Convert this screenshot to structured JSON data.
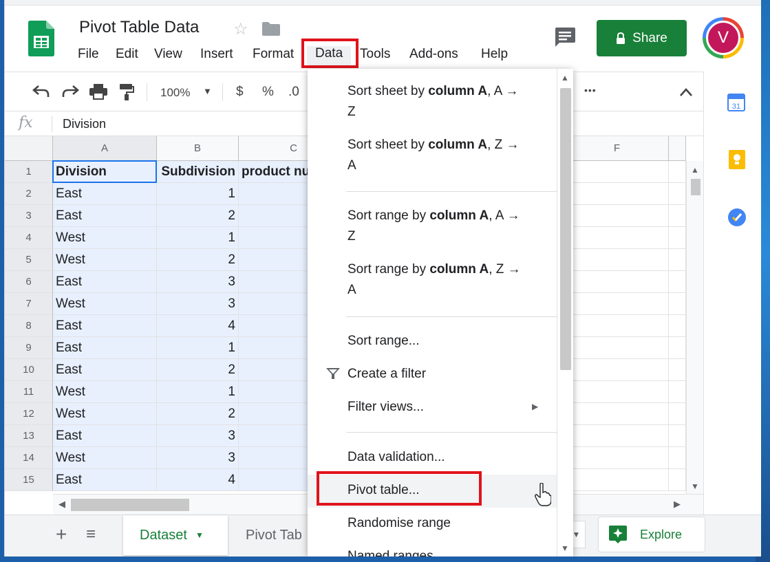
{
  "doc": {
    "title": "Pivot Table Data"
  },
  "menus": [
    "File",
    "Edit",
    "View",
    "Insert",
    "Format",
    "Data",
    "Tools",
    "Add-ons",
    "Help"
  ],
  "header": {
    "share_label": "Share",
    "avatar_initial": "V"
  },
  "toolbar": {
    "zoom": "100%",
    "currency": "$",
    "percent": "%",
    "decimal": ".0",
    "more": "•••"
  },
  "formula_bar": {
    "fx": "fx",
    "value": "Division"
  },
  "grid": {
    "columns": [
      "A",
      "B",
      "C",
      "F"
    ],
    "header_row": [
      "Division",
      "Subdivision",
      "product nu"
    ],
    "rows": [
      {
        "n": "1"
      },
      {
        "n": "2",
        "a": "East",
        "b": "1"
      },
      {
        "n": "3",
        "a": "East",
        "b": "2"
      },
      {
        "n": "4",
        "a": "West",
        "b": "1"
      },
      {
        "n": "5",
        "a": "West",
        "b": "2"
      },
      {
        "n": "6",
        "a": "East",
        "b": "3"
      },
      {
        "n": "7",
        "a": "West",
        "b": "3"
      },
      {
        "n": "8",
        "a": "East",
        "b": "4"
      },
      {
        "n": "9",
        "a": "East",
        "b": "1"
      },
      {
        "n": "10",
        "a": "East",
        "b": "2"
      },
      {
        "n": "11",
        "a": "West",
        "b": "1"
      },
      {
        "n": "12",
        "a": "West",
        "b": "2"
      },
      {
        "n": "13",
        "a": "East",
        "b": "3"
      },
      {
        "n": "14",
        "a": "West",
        "b": "3"
      },
      {
        "n": "15",
        "a": "East",
        "b": "4"
      }
    ]
  },
  "sheets": {
    "active": "Dataset",
    "other": "Pivot Tab",
    "explore": "Explore"
  },
  "dropdown": {
    "sort_sheet_az": {
      "pre": "Sort sheet by ",
      "col": "column A",
      "post": ", A →",
      "line2": "Z"
    },
    "sort_sheet_za": {
      "pre": "Sort sheet by ",
      "col": "column A",
      "post": ", Z →",
      "line2": "A"
    },
    "sort_range_az": {
      "pre": "Sort range by ",
      "col": "column A",
      "post": ", A →",
      "line2": "Z"
    },
    "sort_range_za": {
      "pre": "Sort range by ",
      "col": "column A",
      "post": ", Z →",
      "line2": "A"
    },
    "sort_range": "Sort range...",
    "create_filter": "Create a filter",
    "filter_views": "Filter views...",
    "data_validation": "Data validation...",
    "pivot_table": "Pivot table...",
    "randomise": "Randomise range",
    "named_ranges": "Named ranges..."
  },
  "colors": {
    "accent": "#188038",
    "highlight": "#e0131b",
    "selection": "#e8f0fe"
  }
}
